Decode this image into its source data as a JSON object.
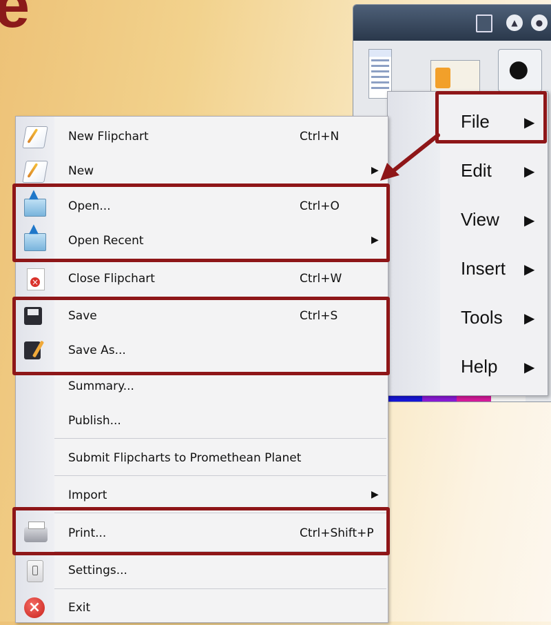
{
  "slide": {
    "title_fragment": "e"
  },
  "app_window": {
    "palette_colors": [
      "#1616d8",
      "#8a1ad6",
      "#d61a9a",
      "#f2f2f2"
    ]
  },
  "file_menu": {
    "items": [
      {
        "label": "New Flipchart",
        "shortcut": "Ctrl+N",
        "icon": "flipchart-icon",
        "submenu": false
      },
      {
        "label": "New",
        "shortcut": "",
        "icon": "flipchart-icon",
        "submenu": true
      },
      {
        "label": "Open...",
        "shortcut": "Ctrl+O",
        "icon": "open-folder-icon",
        "submenu": false
      },
      {
        "label": "Open Recent",
        "shortcut": "",
        "icon": "open-folder-icon",
        "submenu": true
      },
      {
        "label": "Close Flipchart",
        "shortcut": "Ctrl+W",
        "icon": "close-document-icon",
        "submenu": false
      },
      {
        "label": "Save",
        "shortcut": "Ctrl+S",
        "icon": "save-icon",
        "submenu": false
      },
      {
        "label": "Save As...",
        "shortcut": "",
        "icon": "save-as-icon",
        "submenu": false
      },
      {
        "label": "Summary...",
        "shortcut": "",
        "icon": "",
        "submenu": false
      },
      {
        "label": "Publish...",
        "shortcut": "",
        "icon": "",
        "submenu": false
      },
      {
        "label": "Submit Flipcharts to Promethean Planet",
        "shortcut": "",
        "icon": "",
        "submenu": false
      },
      {
        "label": "Import",
        "shortcut": "",
        "icon": "",
        "submenu": true
      },
      {
        "label": "Print...",
        "shortcut": "Ctrl+Shift+P",
        "icon": "printer-icon",
        "submenu": false
      },
      {
        "label": "Settings...",
        "shortcut": "",
        "icon": "settings-icon",
        "submenu": false
      },
      {
        "label": "Exit",
        "shortcut": "",
        "icon": "exit-icon",
        "submenu": false
      }
    ],
    "arrow_glyph": "▶"
  },
  "main_menu": {
    "items": [
      {
        "label": "File"
      },
      {
        "label": "Edit"
      },
      {
        "label": "View"
      },
      {
        "label": "Insert"
      },
      {
        "label": "Tools"
      },
      {
        "label": "Help"
      }
    ],
    "arrow_glyph": "▶"
  },
  "colors": {
    "highlight": "#8e1618",
    "title": "#8b1a1a",
    "menu_bg": "#f3f3f4"
  }
}
